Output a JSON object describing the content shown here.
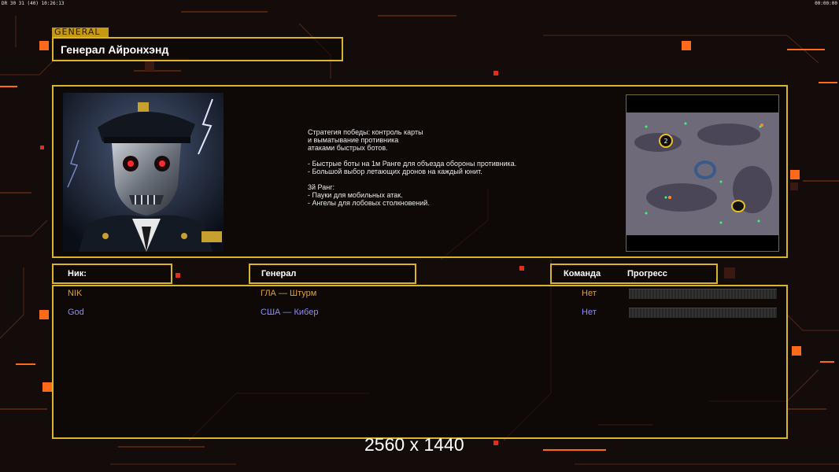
{
  "hud": {
    "left": "DR 30 31 (40) 10:26:13",
    "right": "00:00:00"
  },
  "section_tag": "GENERAL",
  "general_name": "Генерал Айронхэнд",
  "portrait": {
    "icon": "cyborg-general-portrait"
  },
  "description": "Стратегия победы: контроль карты\nи выматывание противника\nатаками быстрых ботов.\n\n- Быстрые боты на 1м Ранге для объезда обороны противника.\n- Большой выбор летающих дронов на каждый юнит.\n\n3й Ранг:\n- Пауки для мобильных атак.\n- Ангелы для лобовых столкновений.",
  "minimap": {
    "icon": "minimap",
    "player_marker": "2"
  },
  "columns": {
    "nick": "Ник:",
    "general": "Генерал",
    "team": "Команда",
    "progress": "Прогресс"
  },
  "players": [
    {
      "nick": "NIK",
      "general": "ГЛА — Штурм",
      "team": "Нет",
      "progress": 0,
      "color": "#e0a03a"
    },
    {
      "nick": "God",
      "general": "США — Кибер",
      "team": "Нет",
      "progress": 0,
      "color": "#8c8cff"
    }
  ],
  "watermark": "2560 x 1440",
  "colors": {
    "frame": "#d8b52a",
    "accent": "#ff6a1a",
    "background": "#140c0a"
  }
}
